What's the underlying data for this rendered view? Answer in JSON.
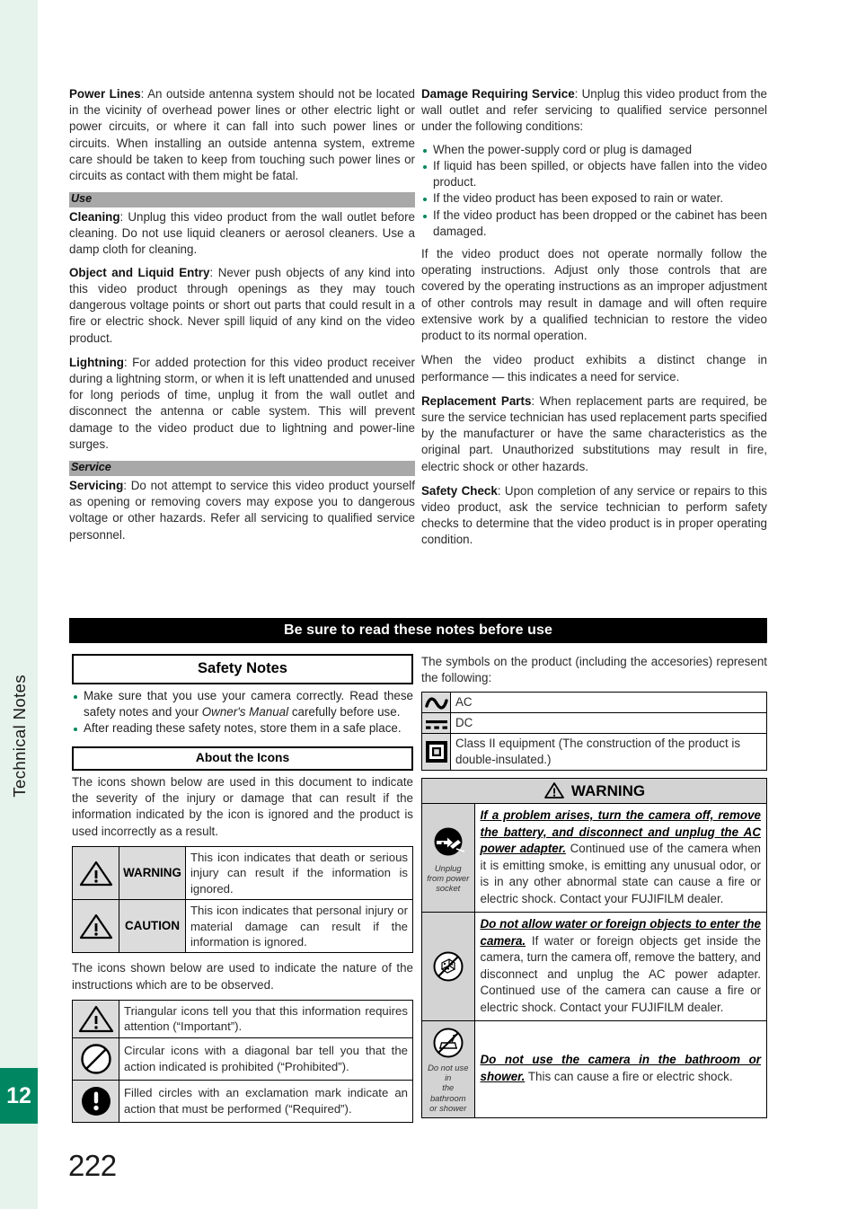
{
  "sidebar": {
    "chapter_label": "Technical Notes",
    "chapter_number": "12",
    "tab_color": "#008761",
    "background_color": "#e6f2ec"
  },
  "page_number": "222",
  "bullet_color": "#00875a",
  "left_column": {
    "paragraphs": [
      {
        "lead": "Power Lines",
        "text": ": An outside antenna system should not be located in the vicinity of overhead power lines or other electric light or power circuits, or where it can fall into such power lines or circuits. When installing an outside antenna system, extreme care should be taken to keep from touching such power lines or circuits as contact with them might be fatal."
      }
    ],
    "section_use": "Use",
    "use_paragraphs": [
      {
        "lead": "Cleaning",
        "text": ": Unplug this video product from the wall outlet before cleaning.  Do not use liquid cleaners or aerosol cleaners.  Use a damp cloth for cleaning."
      },
      {
        "lead": "Object and Liquid Entry",
        "text": ": Never push objects of any kind into this video product through openings as they may touch dangerous voltage points or short out parts that could result in a fire or electric shock.  Never spill liquid of any kind on the video product."
      },
      {
        "lead": "Lightning",
        "text": ": For added protection for this video product receiver during a lightning storm, or when it is left unattended and unused for long periods of time, unplug it from the wall outlet and disconnect the antenna or cable system. This will prevent damage to the video product due to lightning and power-line surges."
      }
    ],
    "section_service": "Service",
    "service_paragraphs": [
      {
        "lead": "Servicing",
        "text": ": Do not attempt to service this video product yourself as opening or removing covers may expose you to dangerous voltage or other hazards.  Refer all servicing to qualified service personnel."
      }
    ]
  },
  "right_column": {
    "damage": {
      "lead": "Damage Requiring Service",
      "text": ": Unplug this video product from the wall outlet and refer servicing to qualified service personnel under the following conditions:"
    },
    "damage_bullets": [
      "When the power-supply cord or plug is damaged",
      "If liquid has been spilled, or objects have fallen into the video product.",
      "If the video product has been exposed to rain or water.",
      "If the video product has been dropped or the cabinet has been damaged."
    ],
    "paragraphs": [
      "If the video product does not operate normally follow the operating instructions.  Adjust only those controls that are covered by the operating instructions as an improper adjustment of other controls may result in damage and will often require extensive work by a qualified technician to restore the video product to its normal operation.",
      "When the video product exhibits a distinct change in performance — this indicates a need for service."
    ],
    "replacement": {
      "lead": "Replacement Parts",
      "text": ": When replacement parts are required, be sure the service technician has used replacement parts specified by the manufacturer or have the same characteristics as the original part.  Unauthorized substitutions may result in fire, electric shock or other hazards."
    },
    "safety_check": {
      "lead": "Safety Check",
      "text": ": Upon completion of any service or repairs to this video product, ask the service technician to perform safety checks to determine that the video product is in proper operating condition."
    }
  },
  "banner": {
    "title": "Be sure to read these notes before use"
  },
  "safety_notes": {
    "heading": "Safety Notes",
    "bullets": [
      {
        "part1": "Make sure that you use your camera correctly.  Read these safety notes and your ",
        "italic": "Owner's Manual",
        "part2": " carefully before use."
      },
      {
        "part1": "After reading these safety notes, store them in a safe place.",
        "italic": "",
        "part2": ""
      }
    ],
    "about_icons_heading": "About the Icons",
    "about_icons_text": "The icons shown below are used in this document to indicate the severity of the injury or damage that can result if the information indicated by the icon is ignored and the product is used incorrectly as a result.",
    "severity_rows": [
      {
        "icon": "warning-triangle-icon",
        "label": "WARNING",
        "text": "This icon indicates that death or serious injury can result if the information is ignored."
      },
      {
        "icon": "caution-triangle-icon",
        "label": "CAUTION",
        "text": "This icon indicates that personal injury or material damage can result if the information is ignored."
      }
    ],
    "nature_text": "The icons shown below are used to indicate the nature of the instructions which are to be observed.",
    "nature_rows": [
      {
        "icon": "triangle-important-icon",
        "text": "Triangular icons tell you that this information requires attention (“Important”)."
      },
      {
        "icon": "circle-prohibited-icon",
        "text": "Circular icons with a diagonal bar tell you that the action indicated is prohibited (“Prohibited”)."
      },
      {
        "icon": "filled-circle-required-icon",
        "text": "Filled circles with an exclamation mark indicate an action that must be performed (“Required”)."
      }
    ]
  },
  "symbols": {
    "intro": "The symbols on the product (including the accesories) represent the following:",
    "rows": [
      {
        "icon": "ac-sine-icon",
        "text": "AC"
      },
      {
        "icon": "dc-dashes-icon",
        "text": "DC"
      },
      {
        "icon": "class-ii-square-icon",
        "text": "Class II equipment (The construction of the product is double-insulated.)"
      }
    ]
  },
  "warning_panel": {
    "heading": "WARNING",
    "heading_icon": "warning-triangle-icon",
    "rows": [
      {
        "icon": "unplug-power-icon",
        "caption": "Unplug\nfrom power\nsocket",
        "bold": "If a problem arises, turn the camera off, remove the battery, and disconnect and unplug the AC power adapter.",
        "text": " Continued use of the camera when it is emitting smoke, is emitting any unusual odor, or is in any other abnormal state can cause a fire or electric shock.  Contact your FUJIFILM dealer."
      },
      {
        "icon": "no-water-entry-icon",
        "caption": "",
        "bold": "Do not allow water or foreign objects to enter the camera.",
        "text": " If water or foreign objects get inside the camera, turn the camera off, remove the battery, and disconnect and unplug the AC power adapter. Continued use of the camera can cause a fire or electric shock.  Contact your FUJIFILM dealer."
      },
      {
        "icon": "no-bathroom-icon",
        "caption": "Do not use in\nthe bathroom\nor shower",
        "bold": "Do not use the camera in the bathroom or shower.",
        "text": " This can cause a fire or electric shock."
      }
    ]
  }
}
